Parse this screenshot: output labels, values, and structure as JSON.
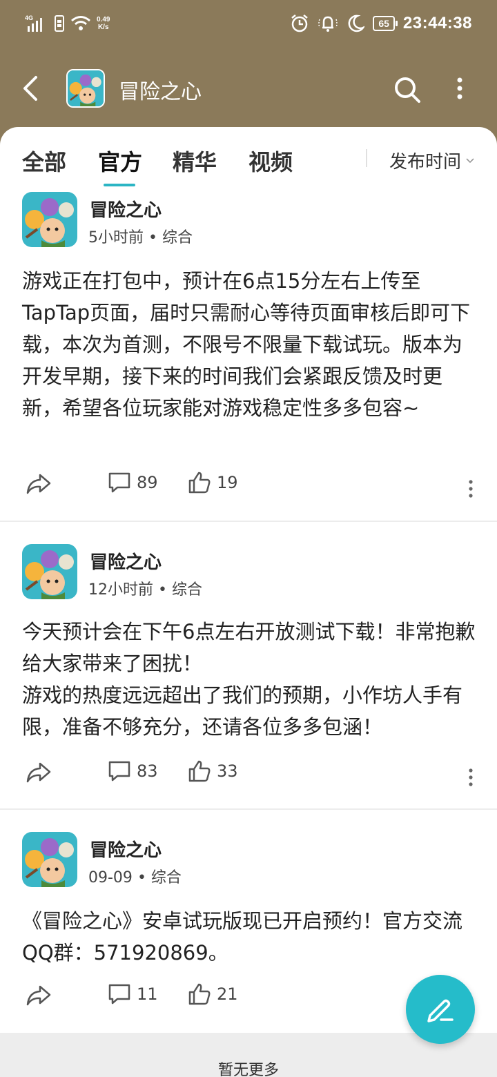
{
  "status_bar": {
    "network": "4G",
    "speed_value": "0.49",
    "speed_unit": "K/s",
    "battery": "65",
    "time": "23:44:38"
  },
  "header": {
    "title": "冒险之心"
  },
  "tabs": [
    {
      "label": "全部",
      "active": false
    },
    {
      "label": "官方",
      "active": true
    },
    {
      "label": "精华",
      "active": false
    },
    {
      "label": "视频",
      "active": false
    }
  ],
  "sort": {
    "label": "发布时间"
  },
  "posts": [
    {
      "author": "冒险之心",
      "time": "5小时前",
      "category": "综合",
      "content": "游戏正在打包中，预计在6点15分左右上传至TapTap页面，届时只需耐心等待页面审核后即可下载，本次为首测，不限号不限量下载试玩。版本为开发早期，接下来的时间我们会紧跟反馈及时更新，希望各位玩家能对游戏稳定性多多包容~",
      "comments": "89",
      "likes": "19"
    },
    {
      "author": "冒险之心",
      "time": "12小时前",
      "category": "综合",
      "content": "今天预计会在下午6点左右开放测试下载！非常抱歉给大家带来了困扰！\n游戏的热度远远超出了我们的预期，小作坊人手有限，准备不够充分，还请各位多多包涵！",
      "comments": "83",
      "likes": "33"
    },
    {
      "author": "冒险之心",
      "time": "09-09",
      "category": "综合",
      "content": "《冒险之心》安卓试玩版现已开启预约！官方交流QQ群：571920869。",
      "comments": "11",
      "likes": "21"
    }
  ],
  "footer": {
    "text": "暂无更多"
  },
  "colors": {
    "accent": "#25bcca",
    "header_bg": "#8b7a5a"
  },
  "icons": [
    "back-arrow-icon",
    "search-icon",
    "more-vertical-icon",
    "share-icon",
    "comment-icon",
    "like-icon",
    "compose-icon",
    "alarm-icon",
    "bell-muted-icon",
    "moon-icon",
    "wifi-icon",
    "signal-icon"
  ]
}
